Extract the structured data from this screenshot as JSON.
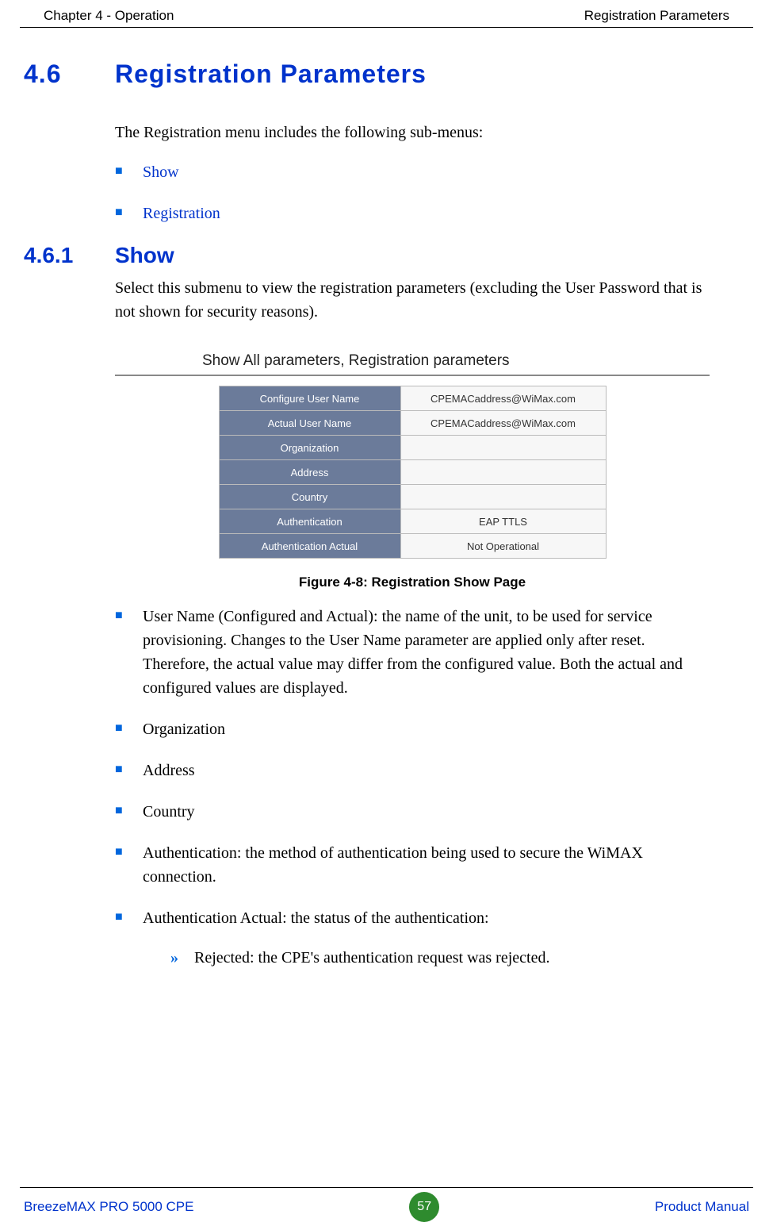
{
  "header": {
    "left": "Chapter 4 - Operation",
    "right": "Registration Parameters"
  },
  "section": {
    "num": "4.6",
    "title": "Registration Parameters",
    "intro": "The Registration menu includes the following sub-menus:",
    "links": [
      "Show",
      "Registration"
    ]
  },
  "subsection": {
    "num": "4.6.1",
    "title": "Show",
    "body": "Select this submenu to view the registration parameters (excluding the User Password that is not shown for security reasons)."
  },
  "figure": {
    "bar_title": "Show All parameters, Registration parameters",
    "rows": [
      {
        "label": "Configure User Name",
        "value": "CPEMACaddress@WiMax.com"
      },
      {
        "label": "Actual User Name",
        "value": "CPEMACaddress@WiMax.com"
      },
      {
        "label": "Organization",
        "value": ""
      },
      {
        "label": "Address",
        "value": ""
      },
      {
        "label": "Country",
        "value": ""
      },
      {
        "label": "Authentication",
        "value": "EAP TTLS"
      },
      {
        "label": "Authentication Actual",
        "value": "Not Operational"
      }
    ],
    "caption": "Figure 4-8: Registration Show Page"
  },
  "bullets": [
    "User Name (Configured and Actual): the name of the unit, to be used for service provisioning. Changes to the User Name parameter are applied only after reset. Therefore, the actual value may differ from the configured value. Both the actual and configured values are displayed.",
    "Organization",
    "Address",
    "Country",
    "Authentication: the method of authentication being used to secure the WiMAX connection.",
    "Authentication Actual: the status of the authentication:"
  ],
  "sub_bullets": [
    "Rejected: the CPE's authentication request was rejected."
  ],
  "footer": {
    "left": "BreezeMAX PRO 5000 CPE",
    "page": "57",
    "right": "Product Manual"
  }
}
